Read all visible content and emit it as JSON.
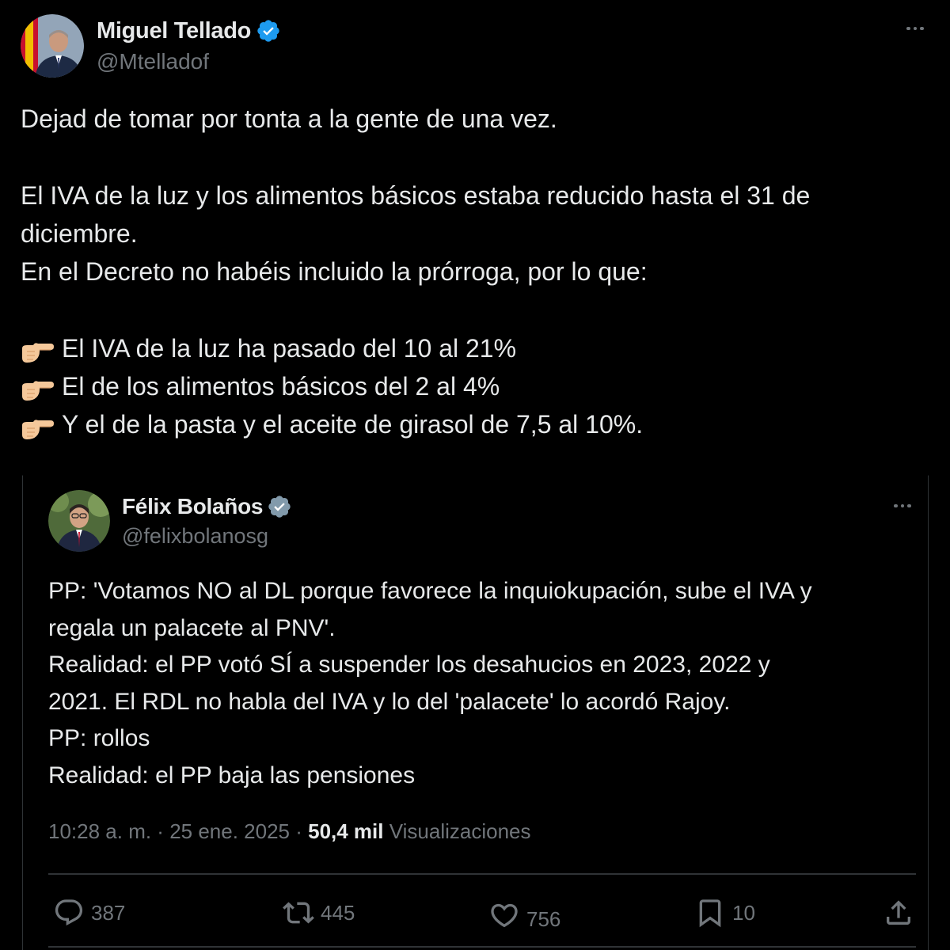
{
  "main_tweet": {
    "author": {
      "display_name": "Miguel Tellado",
      "handle": "@Mtelladof",
      "verified": true
    },
    "text_lines": [
      "Dejad de tomar por tonta a la gente de una vez.",
      "",
      "El IVA de la luz y los alimentos básicos estaba reducido hasta el 31 de",
      "diciembre.",
      "En el Decreto no habéis incluido la prórroga, por lo que:",
      ""
    ],
    "bullets": [
      "El IVA de la luz ha pasado del 10 al 21%",
      "El de los alimentos básicos del 2 al 4%",
      "Y el de la pasta y el aceite de girasol de 7,5 al 10%."
    ],
    "bullet_icon": "pointing-right-hand-icon"
  },
  "quoted_tweet": {
    "author": {
      "display_name": "Félix Bolaños",
      "handle": "@felixbolanosg",
      "verified": true
    },
    "text_lines": [
      "PP: 'Votamos NO al DL porque favorece la inquiokupación, sube el IVA y",
      "regala un palacete al PNV'.",
      "Realidad: el PP votó SÍ a suspender los desahucios en 2023, 2022 y",
      "2021. El RDL no habla del IVA y lo del 'palacete' lo acordó Rajoy.",
      "PP: rollos",
      "Realidad: el PP baja las pensiones"
    ],
    "meta": {
      "time": "10:28 a. m.",
      "separator": " · ",
      "date": "25 ene. 2025",
      "views_count": "50,4 mil",
      "views_label": "Visualizaciones"
    },
    "actions": {
      "replies": "387",
      "reposts": "445",
      "likes": "756",
      "bookmarks": "10"
    }
  },
  "colors": {
    "background": "#000000",
    "text_primary": "#e7e9ea",
    "text_secondary": "#71767b",
    "verified_blue": "#1d9bf0",
    "verified_gray": "#829aab",
    "border": "#2f3336"
  }
}
